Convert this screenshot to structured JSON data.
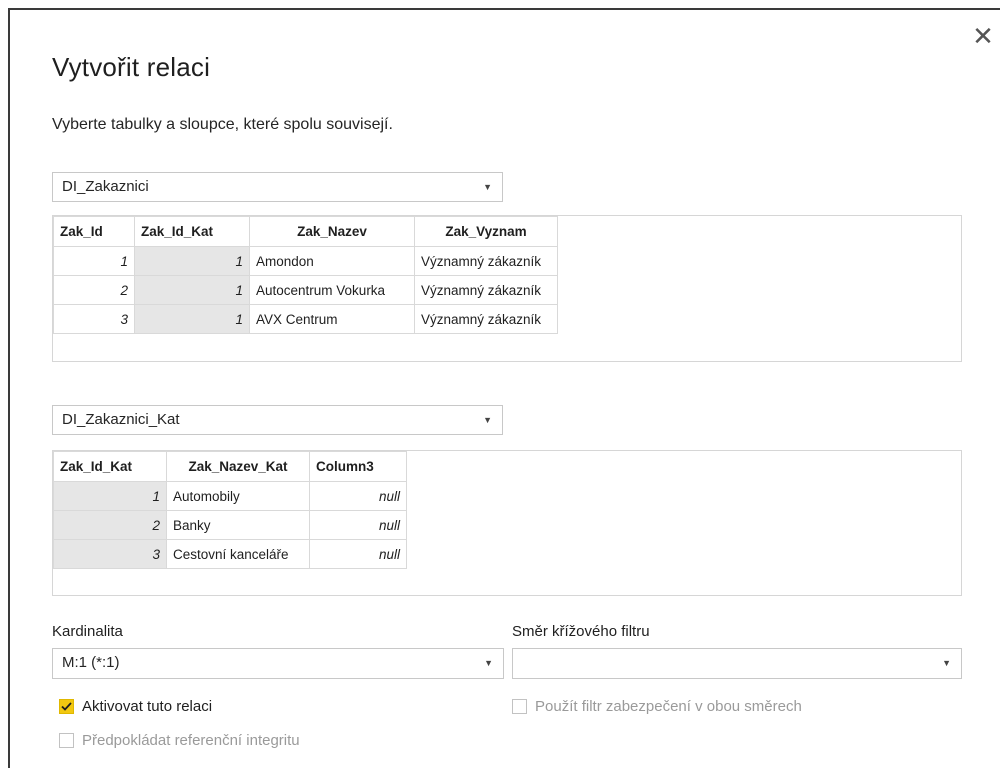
{
  "dialog": {
    "title": "Vytvořit relaci",
    "subtitle": "Vyberte tabulky a sloupce, které spolu souvisejí.",
    "close_icon": "close-icon"
  },
  "table1": {
    "selected": "DI_Zakaznici",
    "columns": [
      "Zak_Id",
      "Zak_Id_Kat",
      "Zak_Nazev",
      "Zak_Vyznam"
    ],
    "rows": [
      [
        "1",
        "1",
        "Amondon",
        "Významný zákazník"
      ],
      [
        "2",
        "1",
        "Autocentrum Vokurka",
        "Významný zákazník"
      ],
      [
        "3",
        "1",
        "AVX Centrum",
        "Významný zákazník"
      ]
    ]
  },
  "table2": {
    "selected": "DI_Zakaznici_Kat",
    "columns": [
      "Zak_Id_Kat",
      "Zak_Nazev_Kat",
      "Column3"
    ],
    "rows": [
      [
        "1",
        "Automobily",
        "null"
      ],
      [
        "2",
        "Banky",
        "null"
      ],
      [
        "3",
        "Cestovní kanceláře",
        "null"
      ]
    ]
  },
  "cardinality": {
    "label": "Kardinalita",
    "value": "M:1 (*:1)"
  },
  "cross_filter": {
    "label": "Směr křížového filtru",
    "value": ""
  },
  "options": {
    "activate": {
      "label": "Aktivovat tuto relaci",
      "checked": true
    },
    "security_filter": {
      "label": "Použít filtr zabezpečení v obou směrech",
      "checked": false,
      "disabled": true
    },
    "referential": {
      "label": "Předpokládat referenční integritu",
      "checked": false,
      "disabled": true
    }
  },
  "colors": {
    "accent": "#f2c811",
    "key_cell": "#e6e6e6"
  }
}
